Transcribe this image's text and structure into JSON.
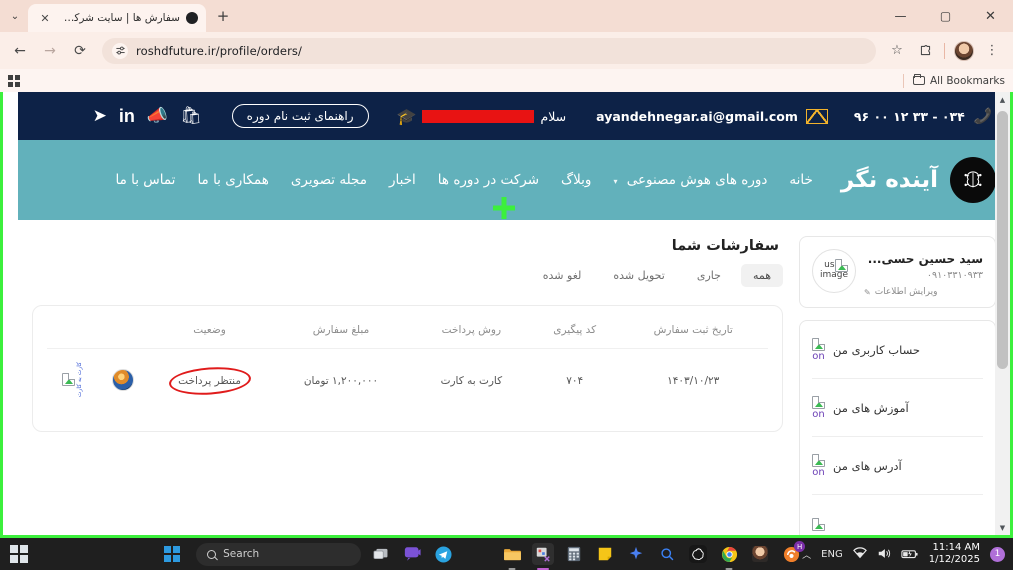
{
  "browser": {
    "tab": {
      "title": "سفارش ها | سایت شرکت فناور آین",
      "close_label": "✕",
      "newtab_label": "+",
      "list_chevron": "⌄"
    },
    "window_controls": {
      "minimize": "—",
      "maximize": "▢",
      "close": "✕"
    },
    "toolbar": {
      "back": "←",
      "forward": "→",
      "reload": "⟳",
      "url": "roshdfuture.ir/profile/orders/",
      "site_settings_icon": "site-settings-icon",
      "star": "☆",
      "extensions": "⊞",
      "menu": "⋮"
    },
    "bookmarks": {
      "apps_label": "apps-grid-icon",
      "all_bookmarks": "All Bookmarks"
    }
  },
  "site": {
    "topbar": {
      "phone": "۰۳۴ - ۳۳ ۱۲ ۰۰ ۹۶",
      "email": "ayandehnegar.ai@gmail.com",
      "greeting": "سلام",
      "username_redacted": "",
      "guide_button": "راهنمای ثبت نام دوره",
      "socials": [
        "telegram-icon",
        "linkedin-icon",
        "whatsapp-icon",
        "cart-icon"
      ]
    },
    "nav": {
      "brand": "آینده نگر",
      "brand_logo": "ai-brain-logo",
      "items": [
        {
          "label": "خانه",
          "has_caret": false
        },
        {
          "label": "دوره های هوش مصنوعی",
          "has_caret": true
        },
        {
          "label": "وبلاگ",
          "has_caret": false
        },
        {
          "label": "شرکت در دوره ها",
          "has_caret": false
        },
        {
          "label": "اخبار",
          "has_caret": false
        },
        {
          "label": "مجله تصویری",
          "has_caret": false
        },
        {
          "label": "همکاری با ما",
          "has_caret": false
        },
        {
          "label": "تماس با ما",
          "has_caret": false
        }
      ]
    },
    "sidebar": {
      "profile": {
        "name": "سید حسین حسی...",
        "phone": "۰۹۱۰۳۳۱۰۹۳۳",
        "edit_label": "ویرایش اطلاعات",
        "avatar_alt": "user image"
      },
      "menu": [
        {
          "label": "حساب کاربری من",
          "icon_alt": "on"
        },
        {
          "label": "آموزش های من",
          "icon_alt": "on"
        },
        {
          "label": "آدرس های من",
          "icon_alt": "on"
        }
      ]
    },
    "orders": {
      "title": "سفارشات شما",
      "filters": [
        {
          "label": "همه",
          "active": true
        },
        {
          "label": "جاری",
          "active": false
        },
        {
          "label": "تحویل شده",
          "active": false
        },
        {
          "label": "لغو شده",
          "active": false
        }
      ],
      "columns": [
        "تاریخ ثبت سفارش",
        "کد پیگیری",
        "روش پرداخت",
        "مبلغ سفارش",
        "وضعیت",
        "",
        ""
      ],
      "rows": [
        {
          "date": "۱۴۰۳/۱۰/۲۳",
          "tracking_code": "۷۰۴",
          "payment_method": "کارت به کارت",
          "amount": "۱,۲۰۰,۰۰۰ تومان",
          "status": "منتظر پرداخت",
          "thumb_alt": "product-thumbnail",
          "broken_alt": "کارت به کارت"
        }
      ],
      "annotation_color": "#e01b1b"
    }
  },
  "taskbar": {
    "search_placeholder": "Search",
    "language": "ENG",
    "time": "11:14 AM",
    "date": "1/12/2025",
    "notification_count": "1",
    "apps": [
      "task-view-icon",
      "teams-icon",
      "telegram-icon",
      "file-explorer-icon",
      "snipping-tool-icon",
      "calculator-icon",
      "notepad-icon",
      "copilot-icon",
      "search-icon",
      "chatgpt-icon",
      "chrome-icon",
      "user-photo-icon",
      "browser-h-icon"
    ]
  }
}
